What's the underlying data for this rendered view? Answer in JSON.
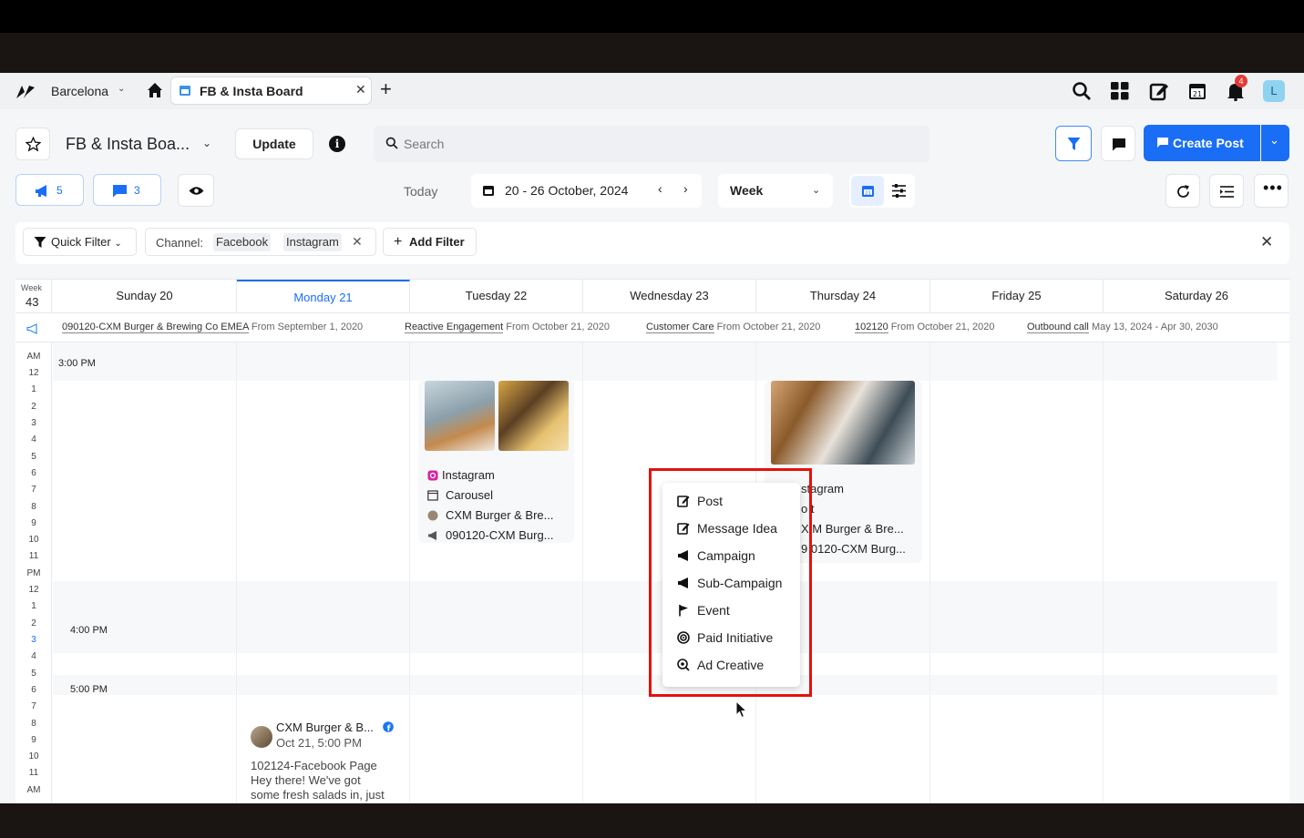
{
  "topbar": {
    "workspace": "Barcelona",
    "tab_label": "FB & Insta Board",
    "notification_count": "4",
    "avatar_letter": "L"
  },
  "header": {
    "board_title": "FB & Insta Boa...",
    "update_label": "Update",
    "search_placeholder": "Search",
    "create_post_label": "Create Post"
  },
  "toolbar": {
    "campaign_count": "5",
    "message_count": "3",
    "today_label": "Today",
    "date_range": "20 - 26 October, 2024",
    "view_mode": "Week"
  },
  "filters": {
    "quick_filter_label": "Quick Filter",
    "channel_label": "Channel:",
    "channel_values": [
      "Facebook",
      "Instagram"
    ],
    "add_filter_label": "Add Filter"
  },
  "calendar": {
    "week_label": "Week",
    "week_number": "43",
    "days": [
      "Sunday 20",
      "Monday 21",
      "Tuesday 22",
      "Wednesday 23",
      "Thursday 24",
      "Friday 25",
      "Saturday 26"
    ],
    "campaigns": [
      {
        "name": "090120-CXM Burger & Brewing Co EMEA",
        "range": "From September 1, 2020"
      },
      {
        "name": "Reactive Engagement",
        "range": "From October 21, 2020"
      },
      {
        "name": "Customer Care",
        "range": "From October 21, 2020"
      },
      {
        "name": "102120",
        "range": "From October 21, 2020"
      },
      {
        "name": "Outbound call",
        "range": "May 13, 2024 - Apr 30, 2030"
      }
    ],
    "hours": [
      "AM",
      "12",
      "1",
      "2",
      "3",
      "4",
      "5",
      "6",
      "7",
      "8",
      "9",
      "10",
      "11",
      "PM",
      "12",
      "1",
      "2",
      "3",
      "4",
      "5",
      "6",
      "7",
      "8",
      "9",
      "10",
      "11",
      "AM"
    ],
    "time_slots": [
      "3:00 PM",
      "4:00 PM",
      "5:00 PM"
    ]
  },
  "posts": {
    "tuesday": {
      "channel": "Instagram",
      "type": "Carousel",
      "account": "CXM Burger & Bre...",
      "campaign": "090120-CXM Burg..."
    },
    "thursday": {
      "channel": "stagram",
      "type": "o t",
      "account": "X M Burger & Bre...",
      "campaign": "9 0120-CXM Burg..."
    },
    "monday": {
      "account": "CXM Burger & B...",
      "time": "Oct 21, 5:00 PM",
      "text_line1": "102124-Facebook Page",
      "text_line2": "Hey there! We've got",
      "text_line3": "some fresh salads in, just"
    }
  },
  "menu": {
    "items": [
      "Post",
      "Message Idea",
      "Campaign",
      "Sub-Campaign",
      "Event",
      "Paid Initiative",
      "Ad Creative"
    ]
  },
  "colors": {
    "accent": "#1a6ef5",
    "highlight": "#e3120b",
    "notification": "#e53935"
  }
}
